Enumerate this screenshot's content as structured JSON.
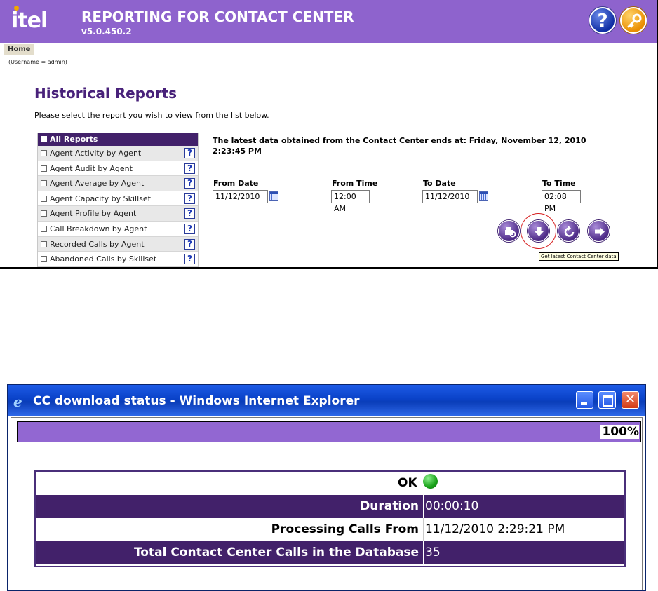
{
  "app": {
    "logo_text": "itel",
    "title": "REPORTING FOR CONTACT CENTER",
    "version": "v5.0.450.2",
    "help_icon": "?",
    "home_tab": "Home",
    "username_note": "(Username = admin)"
  },
  "page": {
    "title": "Historical Reports",
    "intro": "Please select the report you wish to view from the list below."
  },
  "reports": {
    "header": "All Reports",
    "help_glyph": "?",
    "items": [
      {
        "label": "Agent Activity by Agent"
      },
      {
        "label": "Agent Audit by Agent"
      },
      {
        "label": "Agent Average by Agent"
      },
      {
        "label": "Agent Capacity by Skillset"
      },
      {
        "label": "Agent Profile by Agent"
      },
      {
        "label": "Call Breakdown by Agent"
      },
      {
        "label": "Recorded Calls by Agent"
      },
      {
        "label": "Abandoned Calls by Skillset"
      }
    ]
  },
  "latest_data": "The latest data obtained from the Contact Center ends at: Friday, November 12, 2010 2:23:45 PM",
  "filters": {
    "from_date": {
      "label": "From Date",
      "value": "11/12/2010"
    },
    "from_time": {
      "label": "From Time",
      "value": "12:00 AM"
    },
    "to_date": {
      "label": "To Date",
      "value": "11/12/2010"
    },
    "to_time": {
      "label": "To Time",
      "value": "02:08 PM"
    }
  },
  "actions": {
    "icons": [
      "print-settings-icon",
      "download-arrow-icon",
      "refresh-icon",
      "next-arrow-icon"
    ],
    "tooltip": "Get latest Contact Center data"
  },
  "ie_window": {
    "title": "CC download status - Windows Internet Explorer",
    "close_glyph": "✕",
    "progress": {
      "percent": 100,
      "label": "100%"
    },
    "status": {
      "ok_label": "OK",
      "ok_color": "#1aa21a",
      "rows": [
        {
          "label": "Duration",
          "value": "00:00:10"
        },
        {
          "label": "Processing Calls From",
          "value": "11/12/2010 2:29:21 PM"
        },
        {
          "label": "Total Contact Center Calls in the Database",
          "value": "35"
        }
      ]
    }
  },
  "colors": {
    "banner": "#8e63cd",
    "dark_purple": "#42216a",
    "title_purple": "#48217a",
    "progress_fill": "#9267d2",
    "highlight": "#d61e1e"
  }
}
